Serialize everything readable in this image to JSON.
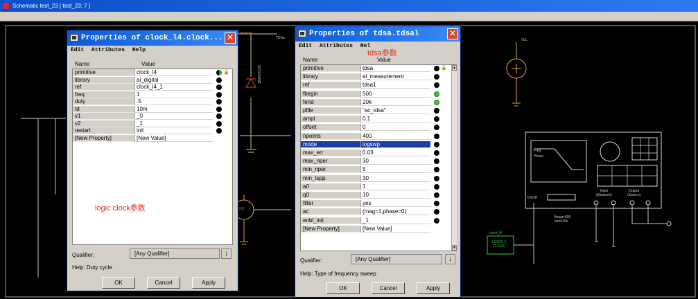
{
  "window": {
    "title": "Schematic test_23 [ test_23: 7 ]"
  },
  "schematic": {
    "labels": {
      "vcc": "VLL",
      "tdsa": "TDSa",
      "diode": "1N4007/Ctrl",
      "freq": "Freq",
      "phase": "Phase",
      "input": "Input\n(Measure)",
      "output": "Output\n(Source)",
      "onoff": "On/Off",
      "clock_name": "clock_l4",
      "clock_block": "LOGIC-4\nCLOCK",
      "fbegin_note": "fbegin:500\nfend:20k",
      "src_value": "2.5"
    }
  },
  "dialog1": {
    "title": "Properties of clock_l4.clock...",
    "menu": [
      "Edit",
      "Attributes",
      "Help"
    ],
    "columns": {
      "name": "Name",
      "value": "Value"
    },
    "rows": [
      {
        "name": "primitive",
        "value": "clock_l4"
      },
      {
        "name": "library",
        "value": "ai_digital"
      },
      {
        "name": "ref",
        "value": "clock_l4_1"
      },
      {
        "name": "freq",
        "value": "1"
      },
      {
        "name": "duty",
        "value": ".5"
      },
      {
        "name": "td",
        "value": "10m"
      },
      {
        "name": "v1",
        "value": "_0"
      },
      {
        "name": "v2",
        "value": "_1"
      },
      {
        "name": "restart",
        "value": "init"
      },
      {
        "name": "[New Property]",
        "value": "[New Value]"
      }
    ],
    "annotation": "logic clock参数",
    "qualifier_label": "Qualifier:",
    "qualifier_value": "[Any Qualifier]",
    "help": "Help:  Duty cycle",
    "buttons": {
      "ok": "OK",
      "cancel": "Cancel",
      "apply": "Apply"
    }
  },
  "dialog2": {
    "title": "Properties of tdsa.tdsal",
    "menu": [
      "Edit",
      "Attributes",
      "Hel"
    ],
    "columns": {
      "name": "Name",
      "value": "Value"
    },
    "rows": [
      {
        "name": "primitive",
        "value": "tdsa"
      },
      {
        "name": "library",
        "value": "ai_measurement"
      },
      {
        "name": "ref",
        "value": "tdsa1"
      },
      {
        "name": "fbegin",
        "value": "500"
      },
      {
        "name": "fend",
        "value": "20k"
      },
      {
        "name": "pfile",
        "value": "\"ac_tdsa\""
      },
      {
        "name": "ampl",
        "value": "0.1"
      },
      {
        "name": "offset",
        "value": "0"
      },
      {
        "name": "npoints",
        "value": "400"
      },
      {
        "name": "mode",
        "value": "logswp"
      },
      {
        "name": "max_err",
        "value": "0.03"
      },
      {
        "name": "max_nper",
        "value": "30"
      },
      {
        "name": "min_nper",
        "value": "5"
      },
      {
        "name": "min_tspp",
        "value": "30"
      },
      {
        "name": "a0",
        "value": "1"
      },
      {
        "name": "q0",
        "value": "10"
      },
      {
        "name": "filter",
        "value": "yes"
      },
      {
        "name": "ac",
        "value": "(mag=1,phase=0)"
      },
      {
        "name": "enbl_init",
        "value": "_1"
      },
      {
        "name": "[New Property]",
        "value": "[New Value]"
      }
    ],
    "annotation": "tdsa参数",
    "qualifier_label": "Qualifier:",
    "qualifier_value": "[Any Qualifier]",
    "help": "Help:  Type of frequency sweep",
    "buttons": {
      "ok": "OK",
      "cancel": "Cancel",
      "apply": "Apply"
    }
  },
  "colors": {
    "selection": "#1a3fa8",
    "annotation": "#e53020",
    "wire": "#c8c8c8",
    "title_bar": "#0a5ad6"
  }
}
